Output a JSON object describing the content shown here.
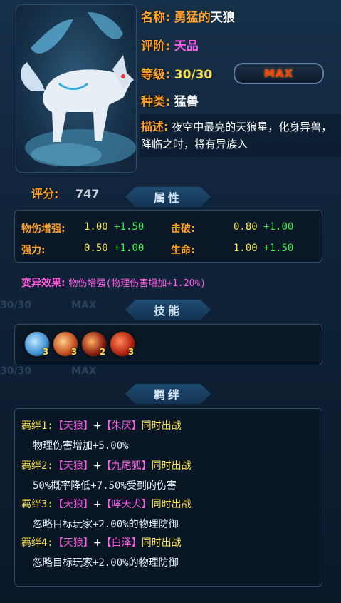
{
  "pet": {
    "name_label": "名称:",
    "name_prefix": "勇猛的",
    "name_main": "天狼",
    "grade_label": "评阶:",
    "grade_value": "天品",
    "level_label": "等级:",
    "level_value": "30/30",
    "max_label": "MAX",
    "type_label": "种类:",
    "type_value": "猛兽",
    "desc_label": "描述:",
    "desc_text": "夜空中最亮的天狼星，化身异兽，降临之时，将有异族入",
    "score_label": "评分:",
    "score_value": "747"
  },
  "sections": {
    "attributes": "属性",
    "skills": "技能",
    "bonds": "羁绊"
  },
  "attributes": [
    {
      "name": "物伤增强:",
      "base": "1.00",
      "bonus": "+1.50"
    },
    {
      "name": "击破:",
      "base": "0.80",
      "bonus": "+1.00"
    },
    {
      "name": "强力:",
      "base": "0.50",
      "bonus": "+1.00"
    },
    {
      "name": "生命:",
      "base": "1.00",
      "bonus": "+1.50"
    }
  ],
  "variant": {
    "label": "变异效果:",
    "value": "物伤增强(物理伤害增加+1.20%)"
  },
  "skills": [
    {
      "icon": "wolf-claw-skill-icon",
      "level": "3",
      "color": "#3a8fd0"
    },
    {
      "icon": "fire-slash-skill-icon",
      "level": "3",
      "color": "#c24a1c"
    },
    {
      "icon": "beast-roar-skill-icon",
      "level": "2",
      "color": "#8a1c10"
    },
    {
      "icon": "flame-strike-skill-icon",
      "level": "3",
      "color": "#b3200e"
    }
  ],
  "bonds": [
    {
      "label": "羁绊1:",
      "self": "【天狼】",
      "plus": "+",
      "partner": "【朱厌】",
      "suffix": "同时出战",
      "effect": "物理伤害增加+5.00%"
    },
    {
      "label": "羁绊2:",
      "self": "【天狼】",
      "plus": "+",
      "partner": "【九尾狐】",
      "suffix": "同时出战",
      "effect": "50%概率降低+7.50%受到的伤害"
    },
    {
      "label": "羁绊3:",
      "self": "【天狼】",
      "plus": "+",
      "partner": "【哮天犬】",
      "suffix": "同时出战",
      "effect": "忽略目标玩家+2.00%的物理防御"
    },
    {
      "label": "羁绊4:",
      "self": "【天狼】",
      "plus": "+",
      "partner": "【白泽】",
      "suffix": "同时出战",
      "effect": "忽略目标玩家+2.00%的物理防御"
    }
  ],
  "background": {
    "ghost_level_1": "30/30",
    "ghost_max_1": "MAX",
    "ghost_level_2": "30/30",
    "ghost_max_2": "MAX"
  },
  "colors": {
    "label_orange": "#ffa229",
    "name_pink": "#ff5ce7",
    "value_yellow": "#f5e64a",
    "bonus_green": "#3cf04a",
    "max_red": "#ff3a1a"
  }
}
